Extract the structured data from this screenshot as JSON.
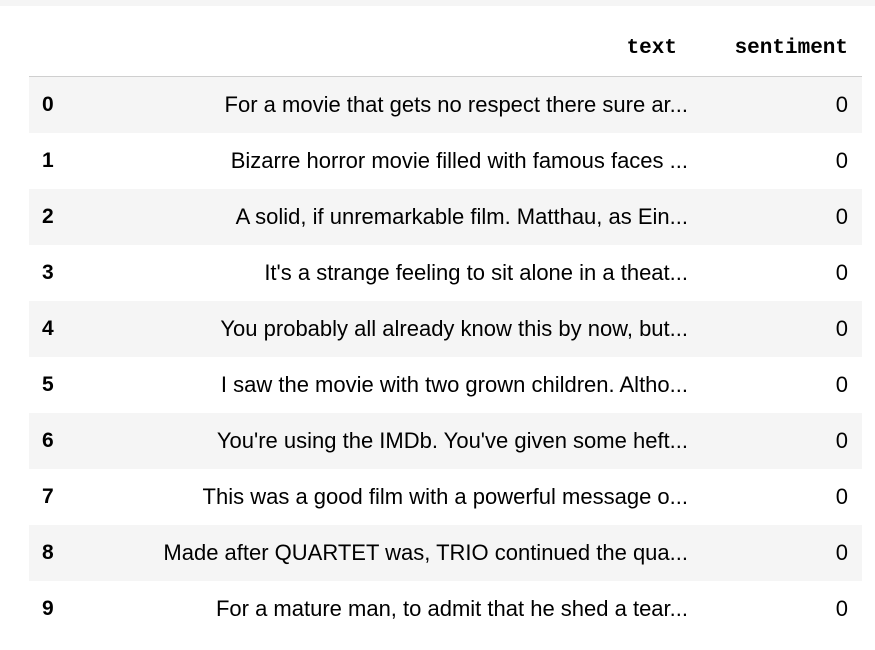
{
  "table": {
    "columns": [
      "",
      "text",
      "sentiment"
    ],
    "rows": [
      {
        "index": "0",
        "text": "For a movie that gets no respect there sure ar...",
        "sentiment": "0"
      },
      {
        "index": "1",
        "text": "Bizarre horror movie filled with famous faces ...",
        "sentiment": "0"
      },
      {
        "index": "2",
        "text": "A solid, if unremarkable film. Matthau, as Ein...",
        "sentiment": "0"
      },
      {
        "index": "3",
        "text": "It's a strange feeling to sit alone in a theat...",
        "sentiment": "0"
      },
      {
        "index": "4",
        "text": "You probably all already know this by now, but...",
        "sentiment": "0"
      },
      {
        "index": "5",
        "text": "I saw the movie with two grown children. Altho...",
        "sentiment": "0"
      },
      {
        "index": "6",
        "text": "You're using the IMDb. You've given some heft...",
        "sentiment": "0"
      },
      {
        "index": "7",
        "text": "This was a good film with a powerful message o...",
        "sentiment": "0"
      },
      {
        "index": "8",
        "text": "Made after QUARTET was, TRIO continued the qua...",
        "sentiment": "0"
      },
      {
        "index": "9",
        "text": "For a mature man, to admit that he shed a tear...",
        "sentiment": "0"
      }
    ]
  },
  "colors": {
    "stripe": "#f5f5f5",
    "header_border": "#cfcfcf",
    "text": "#000000"
  }
}
